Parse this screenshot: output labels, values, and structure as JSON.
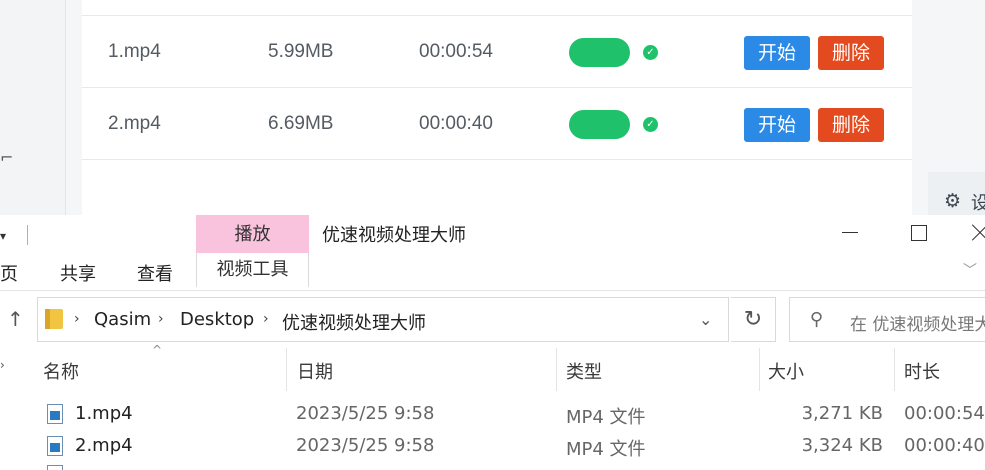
{
  "background_app": {
    "left_glyph": "⌐",
    "rows": [
      {
        "name": "1.mp4",
        "size": "5.99MB",
        "duration": "00:00:54",
        "start_label": "开始",
        "delete_label": "删除"
      },
      {
        "name": "2.mp4",
        "size": "6.69MB",
        "duration": "00:00:40",
        "start_label": "开始",
        "delete_label": "删除"
      }
    ],
    "status_color": "#1fc16b",
    "start_color": "#2b8ae6",
    "delete_color": "#e44a1f",
    "right_panel_text": "设"
  },
  "explorer": {
    "title": "优速视频处理大师",
    "contextual_tab": "播放",
    "contextual_group": "视频工具",
    "contextual_color": "#f9c3dd",
    "ribbon_tabs": {
      "home": "页",
      "share": "共享",
      "view": "查看"
    },
    "address": {
      "crumbs": [
        "Qasim",
        "Desktop",
        "优速视频处理大师"
      ]
    },
    "search": {
      "placeholder": "在 优速视频处理大师 中搜索"
    },
    "columns": {
      "name": "名称",
      "date": "日期",
      "type": "类型",
      "size": "大小",
      "duration": "时长"
    },
    "files": [
      {
        "name": "1.mp4",
        "date": "2023/5/25 9:58",
        "type": "MP4 文件",
        "size": "3,271 KB",
        "duration": "00:00:54"
      },
      {
        "name": "2.mp4",
        "date": "2023/5/25 9:58",
        "type": "MP4 文件",
        "size": "3,324 KB",
        "duration": "00:00:40"
      }
    ]
  }
}
